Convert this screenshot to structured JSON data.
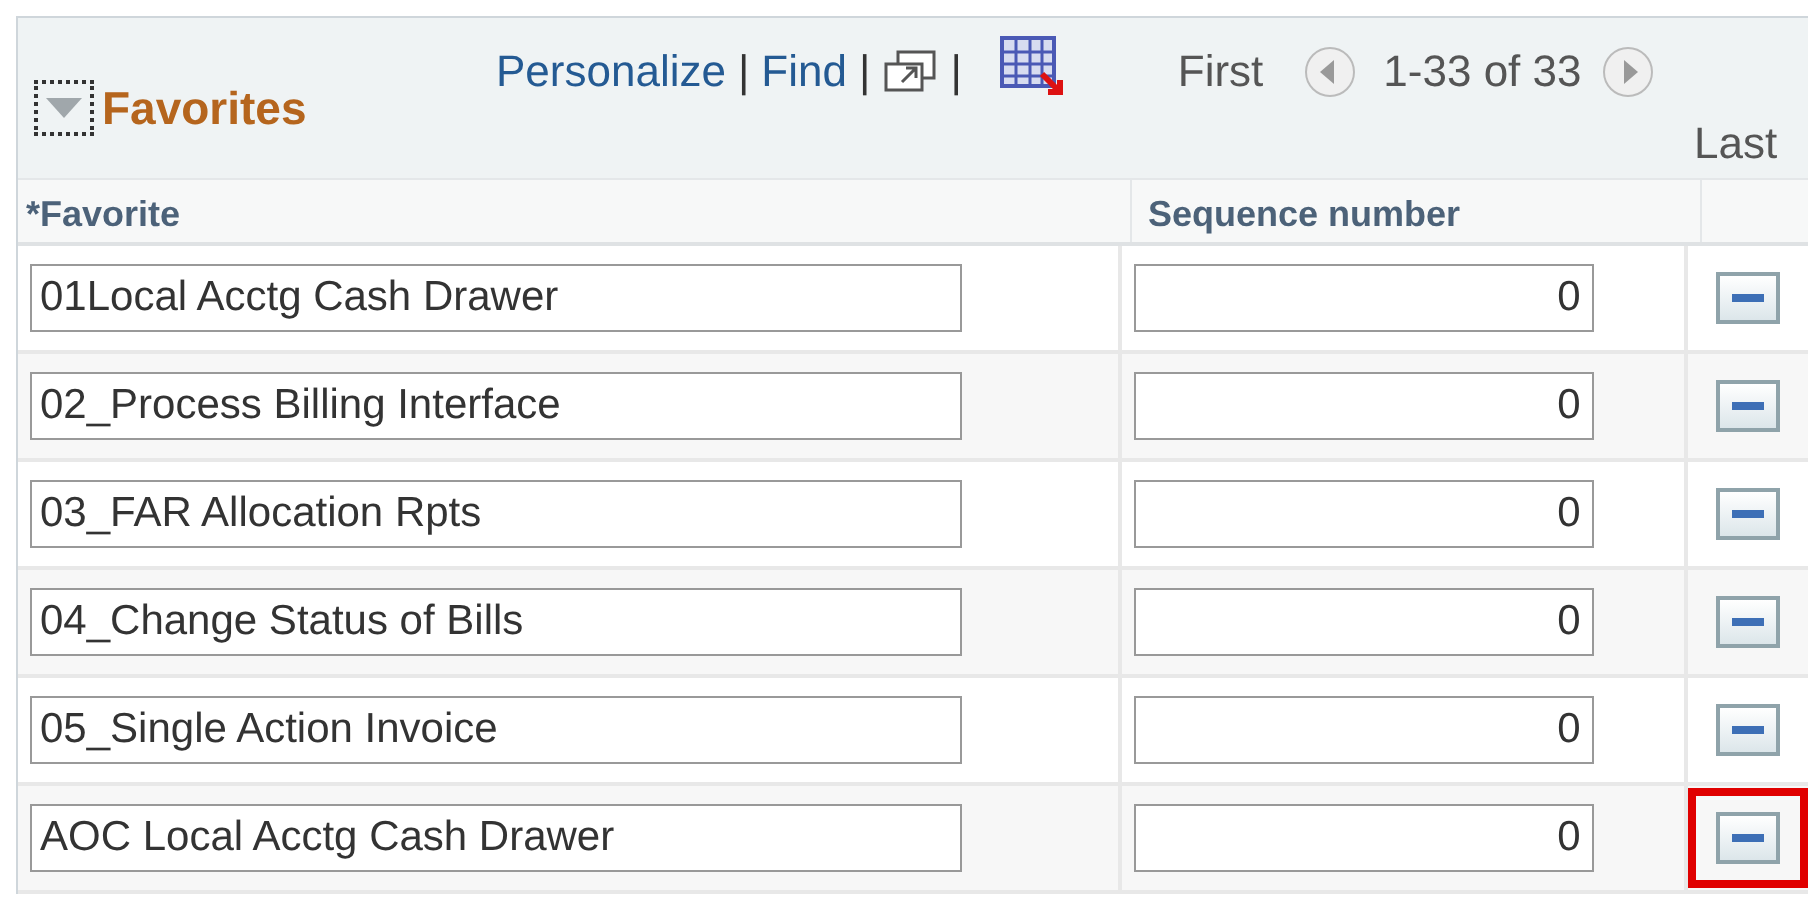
{
  "grid": {
    "title": "Favorites",
    "expanded": true,
    "toolbar": {
      "links": [
        "Personalize",
        "Find"
      ],
      "separators": [
        "|",
        "|",
        "|"
      ],
      "first": "First",
      "range": "1-33 of 33",
      "last": "Last"
    },
    "columns": [
      "*Favorite",
      "Sequence number"
    ],
    "rows": [
      {
        "favorite": "01Local Acctg Cash Drawer",
        "sequence": "0",
        "highlighted": false
      },
      {
        "favorite": "02_Process Billing Interface",
        "sequence": "0",
        "highlighted": false
      },
      {
        "favorite": "03_FAR Allocation Rpts",
        "sequence": "0",
        "highlighted": false
      },
      {
        "favorite": "04_Change Status of Bills",
        "sequence": "0",
        "highlighted": false
      },
      {
        "favorite": "05_Single Action Invoice",
        "sequence": "0",
        "highlighted": false
      },
      {
        "favorite": "AOC Local Acctg Cash Drawer",
        "sequence": "0",
        "highlighted": true
      }
    ]
  }
}
